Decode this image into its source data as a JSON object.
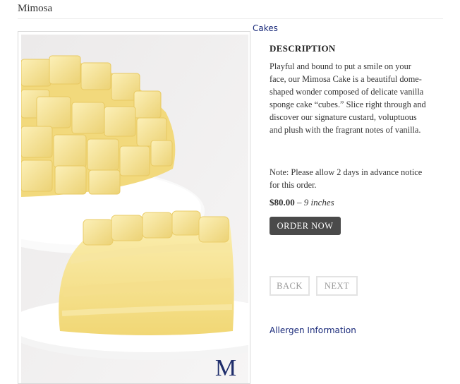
{
  "page": {
    "title": "Mimosa"
  },
  "breadcrumb": {
    "category_link": "Cakes"
  },
  "product": {
    "image_alt": "Mimosa cake slice",
    "logo_letter": "M",
    "description_heading": "DESCRIPTION",
    "description": "Playful and bound to put a smile on your face, our Mimosa Cake is a beautiful dome-shaped wonder composed of delicate vanilla sponge cake “cubes.” Slice right through and discover our signature custard, voluptuous and plush with the fragrant notes of vanilla.",
    "note": "Note: Please allow 2 days in advance notice for this order.",
    "price": "$80.00",
    "price_separator": "–",
    "size": "9 inches",
    "order_label": "ORDER NOW"
  },
  "navigation": {
    "back_label": "BACK",
    "next_label": "NEXT"
  },
  "links": {
    "allergen_label": "Allergen Information"
  },
  "colors": {
    "link": "#1a2a7a",
    "button": "#4a4a4a",
    "cake": "#f3de86"
  },
  "icons": {
    "logo": "monogram-m-logo"
  }
}
